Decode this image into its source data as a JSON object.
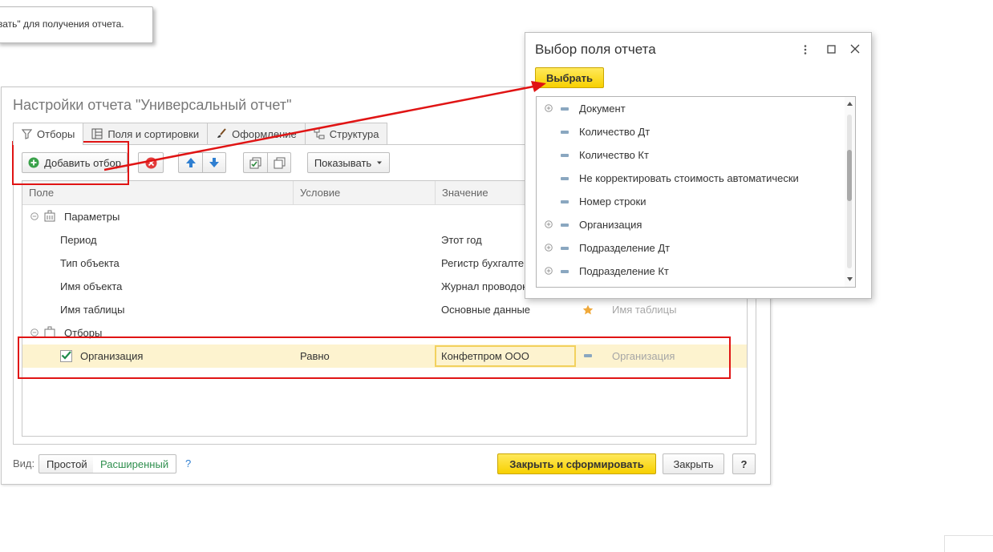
{
  "tooltip": {
    "text": "вать\" для получения отчета."
  },
  "main": {
    "title": "Настройки отчета \"Универсальный отчет\"",
    "tabs": [
      {
        "label": "Отборы",
        "icon": "funnel-icon"
      },
      {
        "label": "Поля и сортировки",
        "icon": "columns-icon"
      },
      {
        "label": "Оформление",
        "icon": "brush-icon"
      },
      {
        "label": "Структура",
        "icon": "structure-icon"
      }
    ],
    "toolbar": {
      "add_filter": "Добавить отбор",
      "show_label": "Показывать"
    },
    "columns": [
      "Поле",
      "Условие",
      "Значение"
    ],
    "groups": {
      "params": "Параметры",
      "filters": "Отборы"
    },
    "param_rows": [
      {
        "field": "Период",
        "value": "Этот год"
      },
      {
        "field": "Тип объекта",
        "value": "Регистр бухгалтер"
      },
      {
        "field": "Имя объекта",
        "value": "Журнал проводок"
      },
      {
        "field": "Имя таблицы",
        "value": "Основные данные",
        "extra": "Имя таблицы"
      }
    ],
    "filter_row": {
      "field": "Организация",
      "condition": "Равно",
      "value": "Конфетпром ООО",
      "extra": "Организация"
    },
    "bottom": {
      "view_label": "Вид:",
      "simple": "Простой",
      "advanced": "Расширенный",
      "help": "?",
      "close_and_build": "Закрыть и сформировать",
      "close": "Закрыть",
      "help_btn": "?"
    }
  },
  "popup": {
    "title": "Выбор поля отчета",
    "select_button": "Выбрать",
    "items": [
      {
        "label": "Документ",
        "expandable": true
      },
      {
        "label": "Количество Дт",
        "expandable": false
      },
      {
        "label": "Количество Кт",
        "expandable": false
      },
      {
        "label": "Не корректировать стоимость автоматически",
        "expandable": false
      },
      {
        "label": "Номер строки",
        "expandable": false
      },
      {
        "label": "Организация",
        "expandable": true
      },
      {
        "label": "Подразделение Дт",
        "expandable": true
      },
      {
        "label": "Подразделение Кт",
        "expandable": true
      }
    ]
  },
  "colors": {
    "accent_yellow": "#f7d000",
    "highlight_row": "#fdf3cf",
    "annotation_red": "#e01414",
    "advanced_green": "#2f8f4e"
  }
}
